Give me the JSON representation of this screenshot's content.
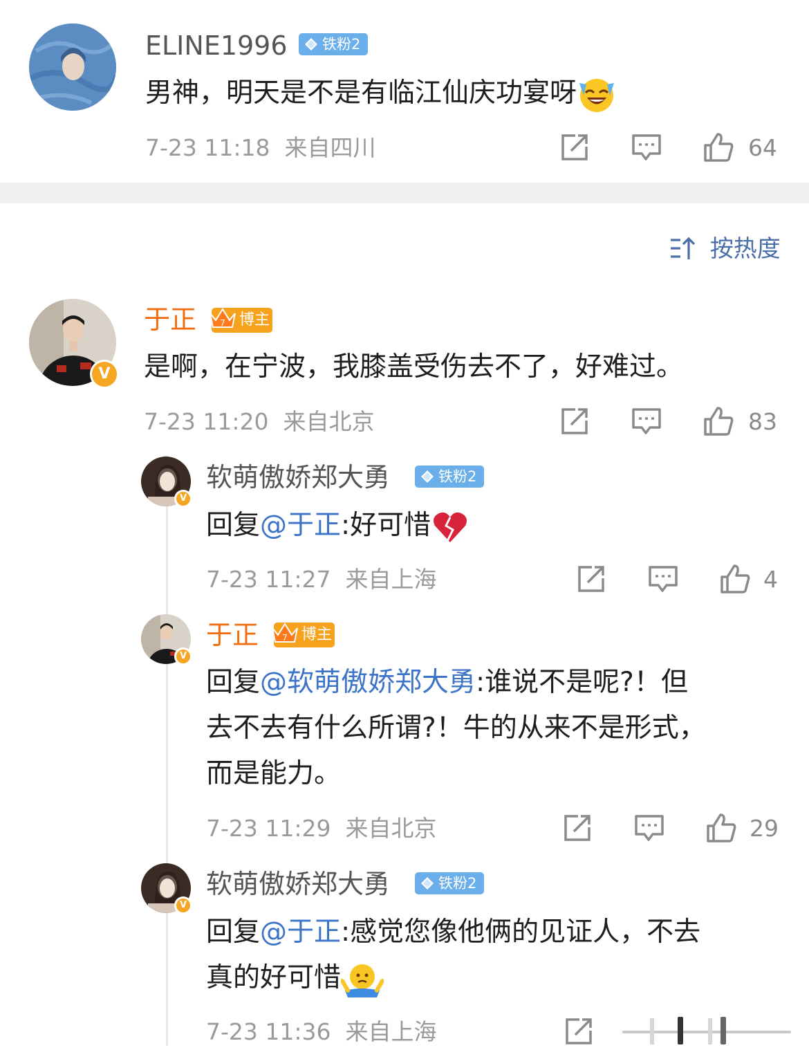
{
  "colors": {
    "mention": "#3d74c8",
    "blogger_name": "#f26d0f",
    "fan_badge": "#6aaeea",
    "blogger_badge": "#f7a21c",
    "verified": "#f5a623"
  },
  "top_comment": {
    "user": "ELINE1996",
    "badge": "铁粉2",
    "text": "男神，明天是不是有临江仙庆功宴呀",
    "emoji": "laughing-tears-emoji",
    "time": "7-23 11:18",
    "location": "来自四川",
    "likes": "64"
  },
  "sort": {
    "label": "按热度",
    "icon": "sort-icon"
  },
  "main_comment": {
    "user": "于正",
    "badge": "博主",
    "verified": "V",
    "text": "是啊，在宁波，我膝盖受伤去不了，好难过。",
    "time": "7-23 11:20",
    "location": "来自北京",
    "likes": "83"
  },
  "replies": [
    {
      "user": "软萌傲娇郑大勇",
      "badge": "铁粉2",
      "prefix": "回复",
      "mention": "@于正",
      "text": ":好可惜",
      "emoji": "broken-heart-emoji",
      "time": "7-23 11:27",
      "location": "来自上海",
      "likes": "4"
    },
    {
      "user": "于正",
      "badge": "博主",
      "verified": "V",
      "prefix": "回复",
      "mention": "@软萌傲娇郑大勇",
      "text_line1": ":谁说不是呢?！但",
      "text_line2": "去不去有什么所谓?！牛的从来不是形式，",
      "text_line3": "而是能力。",
      "time": "7-23 11:29",
      "location": "来自北京",
      "likes": "29"
    },
    {
      "user": "软萌傲娇郑大勇",
      "badge": "铁粉2",
      "prefix": "回复",
      "mention": "@于正",
      "text_line1": ":感觉您像他俩的见证人，不去",
      "text_line2": "真的好可惜",
      "emoji": "shrug-emoji",
      "time": "7-23 11:36",
      "location": "来自上海"
    }
  ]
}
